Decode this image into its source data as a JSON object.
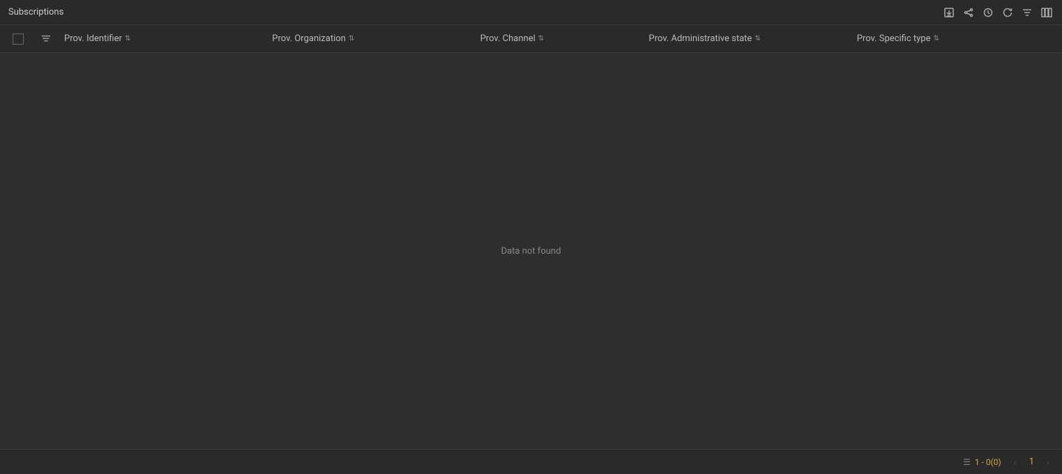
{
  "titleBar": {
    "title": "Subscriptions",
    "icons": {
      "export": "export-icon",
      "share": "share-icon",
      "history": "history-icon",
      "refresh": "refresh-icon",
      "filter": "filter-icon",
      "columns": "columns-icon"
    }
  },
  "table": {
    "columns": [
      {
        "id": "identifier",
        "label": "Prov. Identifier",
        "sortable": true
      },
      {
        "id": "organization",
        "label": "Prov. Organization",
        "sortable": true
      },
      {
        "id": "channel",
        "label": "Prov. Channel",
        "sortable": true
      },
      {
        "id": "admin_state",
        "label": "Prov. Administrative state",
        "sortable": true
      },
      {
        "id": "specific_type",
        "label": "Prov. Specific type",
        "sortable": true
      }
    ],
    "emptyMessage": "Data not found",
    "rows": []
  },
  "pagination": {
    "rangeLabel": "1 - 0(0)",
    "currentPage": "1",
    "prevDisabled": true,
    "nextDisabled": true
  }
}
